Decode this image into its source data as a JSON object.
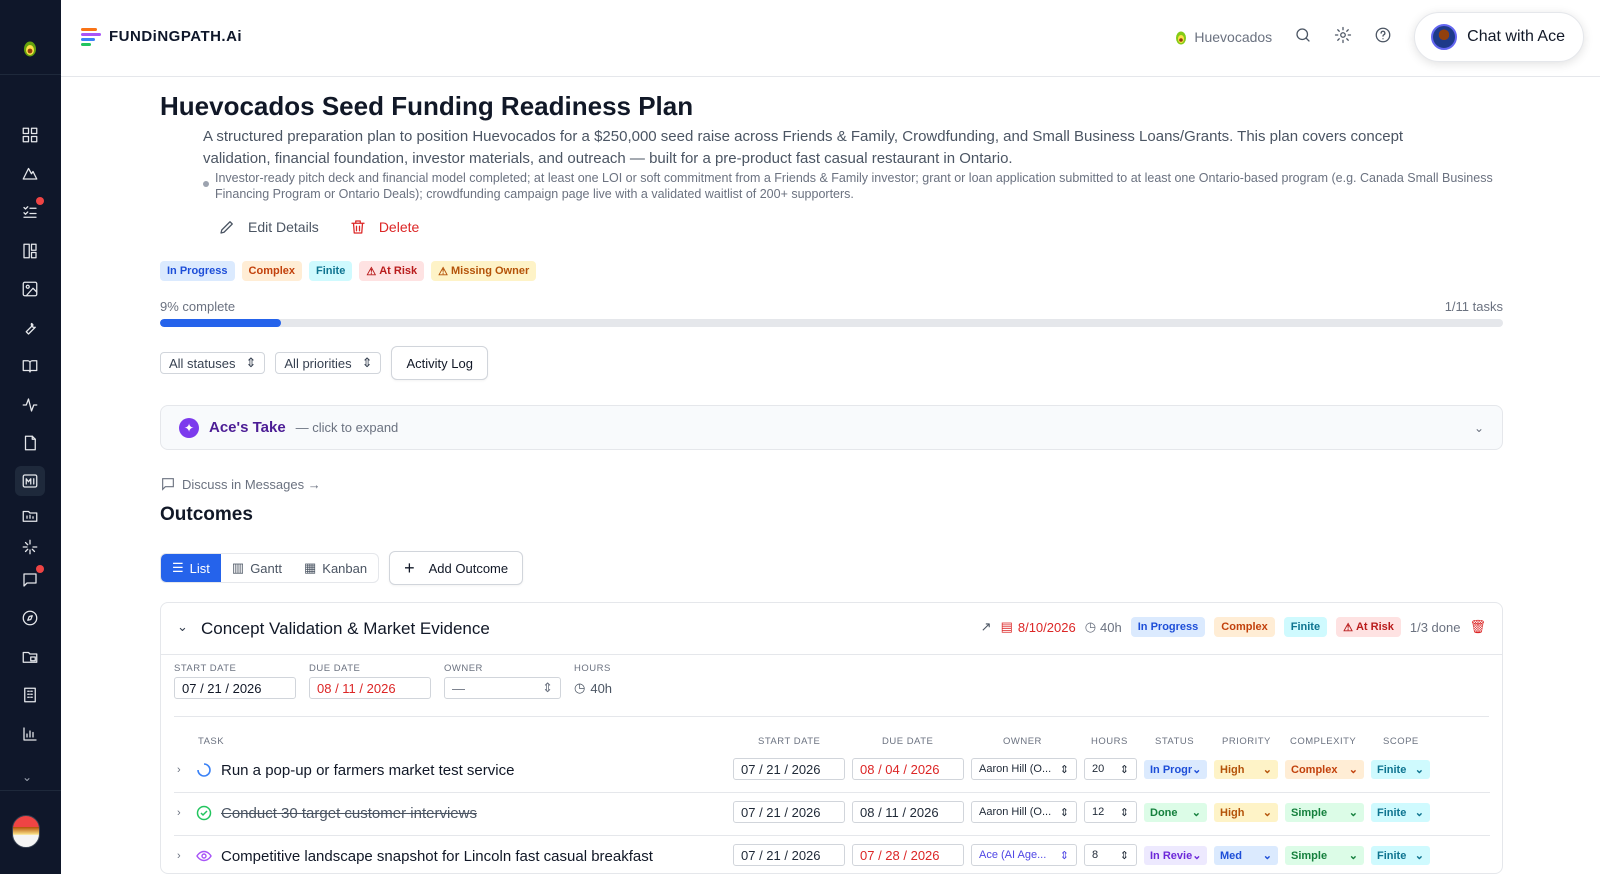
{
  "app": {
    "brand": "FUNDiNGPATH.Ai",
    "company": "Huevocados",
    "chat_label": "Chat with Ace"
  },
  "plan": {
    "title": "Huevocados Seed Funding Readiness Plan",
    "description": "A structured preparation plan to position Huevocados for a $250,000 seed raise across Friends & Family, Crowdfunding, and Small Business Loans/Grants. This plan covers concept validation, financial foundation, investor materials, and outreach — built for a pre-product fast casual restaurant in Ontario.",
    "criteria": "Investor-ready pitch deck and financial model completed; at least one LOI or soft commitment from a Friends & Family investor; grant or loan application submitted to at least one Ontario-based program (e.g. Canada Small Business Financing Program or Ontario Deals); crowdfunding campaign page live with a validated waitlist of 200+ supporters.",
    "edit_label": "Edit Details",
    "delete_label": "Delete",
    "badges": {
      "status": "In Progress",
      "complexity": "Complex",
      "scope": "Finite",
      "risk": "At Risk",
      "owner": "Missing Owner"
    },
    "progress": {
      "percent_label": "9% complete",
      "fraction": 0.09,
      "tasks_label": "1/11 tasks"
    }
  },
  "filters": {
    "status": "All statuses",
    "priority": "All priorities",
    "activity_log": "Activity Log"
  },
  "ace_take": {
    "title": "Ace's Take",
    "subtitle": "— click to expand"
  },
  "discuss_label": "Discuss in Messages →",
  "outcomes_heading": "Outcomes",
  "views": {
    "list": "List",
    "gantt": "Gantt",
    "kanban": "Kanban",
    "add": "Add Outcome"
  },
  "outcome": {
    "title": "Concept Validation & Market Evidence",
    "due": "8/10/2026",
    "hours": "40h",
    "status": "In Progress",
    "complexity": "Complex",
    "scope": "Finite",
    "risk": "At Risk",
    "done": "1/3 done",
    "fields": {
      "start_label": "START DATE",
      "start": "07 / 21 / 2026",
      "due_label": "DUE DATE",
      "due": "08 / 11 / 2026",
      "owner_label": "OWNER",
      "owner": "—",
      "hours_label": "HOURS",
      "hours": "40h"
    },
    "columns": {
      "task": "TASK",
      "start": "START DATE",
      "due": "DUE DATE",
      "owner": "OWNER",
      "hours": "HOURS",
      "status": "STATUS",
      "priority": "PRIORITY",
      "complexity": "COMPLEXITY",
      "scope": "SCOPE"
    },
    "tasks": [
      {
        "name": "Run a pop-up or farmers market test service",
        "start": "07 / 21 / 2026",
        "due": "08 / 04 / 2026",
        "owner": "Aaron Hill (O...",
        "hours": "20",
        "status": "In Progr",
        "priority": "High",
        "complexity": "Complex",
        "scope": "Finite"
      },
      {
        "name": "Conduct 30 target customer interviews",
        "start": "07 / 21 / 2026",
        "due": "08 / 11 / 2026",
        "owner": "Aaron Hill (O...",
        "hours": "12",
        "status": "Done",
        "priority": "High",
        "complexity": "Simple",
        "scope": "Finite"
      },
      {
        "name": "Competitive landscape snapshot for Lincoln fast casual breakfast",
        "start": "07 / 21 / 2026",
        "due": "07 / 28 / 2026",
        "owner": "Ace (AI Age...",
        "hours": "8",
        "status": "In Revie",
        "priority": "Med",
        "complexity": "Simple",
        "scope": "Finite"
      }
    ]
  },
  "colors": {
    "accent": "#2563eb",
    "sidebar": "#0f172a",
    "danger": "#dc2626"
  }
}
